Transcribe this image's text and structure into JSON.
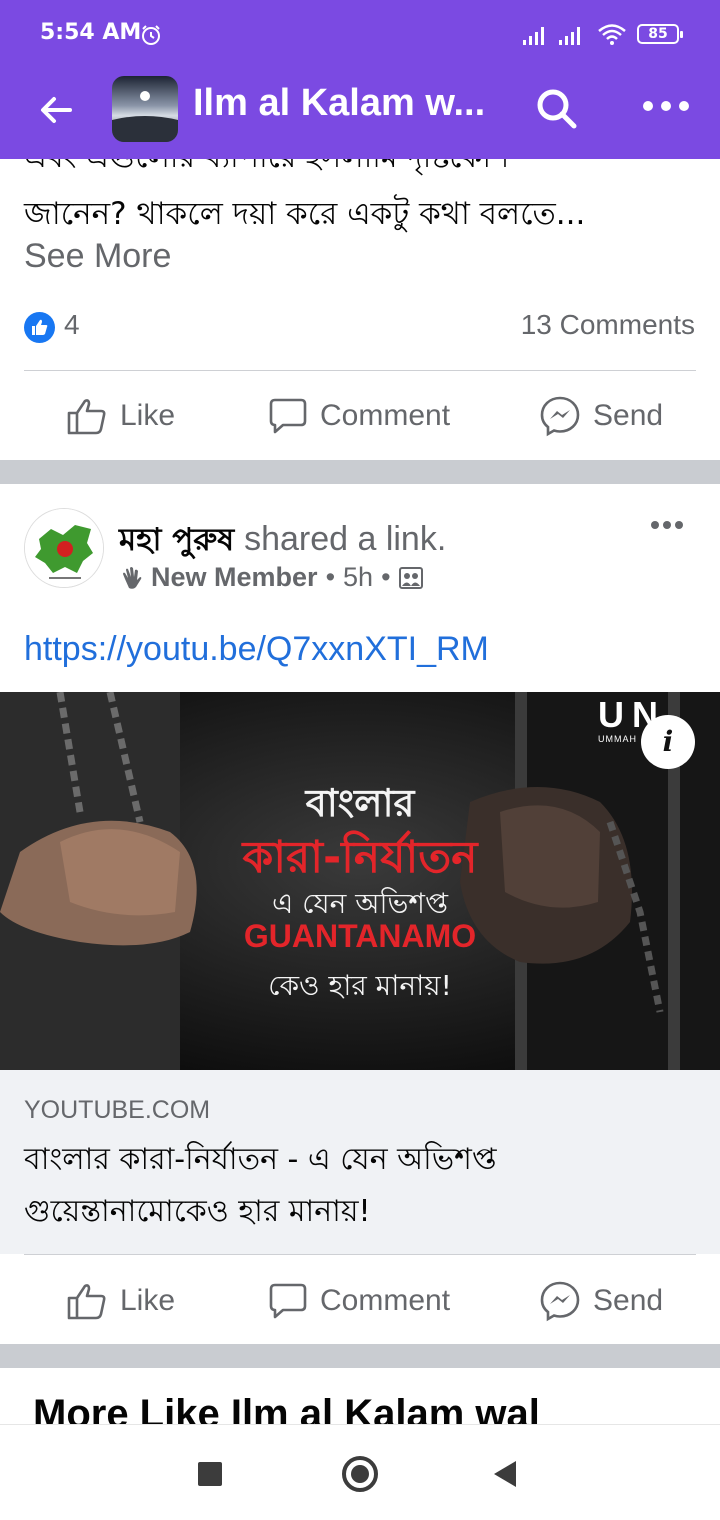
{
  "status_bar": {
    "time": "5:54 AM",
    "battery": "85"
  },
  "header": {
    "title": "Ilm al Kalam w..."
  },
  "post1": {
    "cut_text": "এবং এগুলোর ব্যাপারে ইসলামি দৃষ্টিকোণ",
    "body_line": "জানেন? থাকলে দয়া করে একটু কথা বলতে...",
    "see_more": "See More",
    "reaction_count": "4",
    "comment_count": "13 Comments"
  },
  "actions": {
    "like": "Like",
    "comment": "Comment",
    "send": "Send"
  },
  "post2": {
    "author": "মহা পুরুষ",
    "shared_text": "shared a link.",
    "badge": "New Member",
    "time": "5h",
    "link": "https://youtu.be/Q7xxnXTI_RM",
    "thumbnail": {
      "line1": "বাংলার",
      "line2": "কারা-নির্যাতন",
      "line3": "এ যেন অভিশপ্ত",
      "line4": "GUANTANAMO",
      "line5": "কেও হার মানায়!",
      "logo": "UN",
      "logo_sub": "UMMAH"
    },
    "preview": {
      "domain": "YOUTUBE.COM",
      "title": "বাংলার কারা-নির্যাতন - এ যেন অভিশপ্ত গুয়েন্তানামোকেও হার মানায়!"
    }
  },
  "more_like": {
    "title": "More Like Ilm al Kalam wal"
  },
  "colors": {
    "header": "#7b4ae2",
    "link": "#216fdb",
    "muted": "#65676b",
    "like_blue": "#1877f2"
  }
}
